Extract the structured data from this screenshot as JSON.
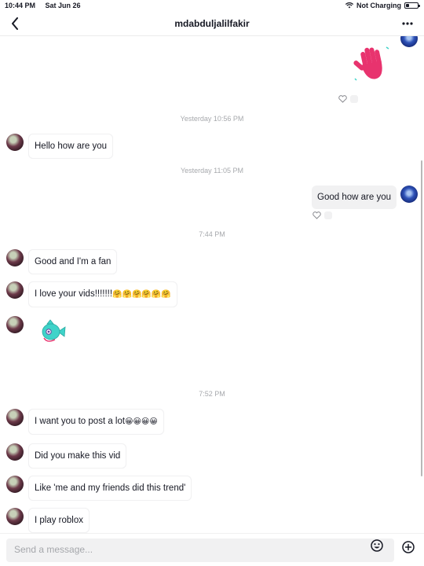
{
  "status_bar": {
    "time": "10:44 PM",
    "date": "Sat Jun 26",
    "charging": "Not Charging",
    "battery_level": 0.25
  },
  "header": {
    "username": "mdabduljalilfakir"
  },
  "timestamps": {
    "t1": "Yesterday 10:56 PM",
    "t2": "Yesterday 11:05 PM",
    "t3": "7:44 PM",
    "t4": "7:52 PM"
  },
  "messages": {
    "m1": "Hello how are you",
    "m2": "Good how are you",
    "m3": "Good and I'm a fan",
    "m4": "I love your vids!!!!!!!",
    "m4_emojis": "🤗🤗🤗🤗🤗🤗",
    "m5": "I want you to post a lot",
    "m5_emojis": "😀😀😀😀",
    "m6": "Did you make this vid",
    "m7": "Like 'me and my friends did this trend'",
    "m8": "I play roblox"
  },
  "composer": {
    "placeholder": "Send a message..."
  },
  "colors": {
    "accent_red": "#e8336e",
    "sticker_teal": "#3fd3c9"
  }
}
